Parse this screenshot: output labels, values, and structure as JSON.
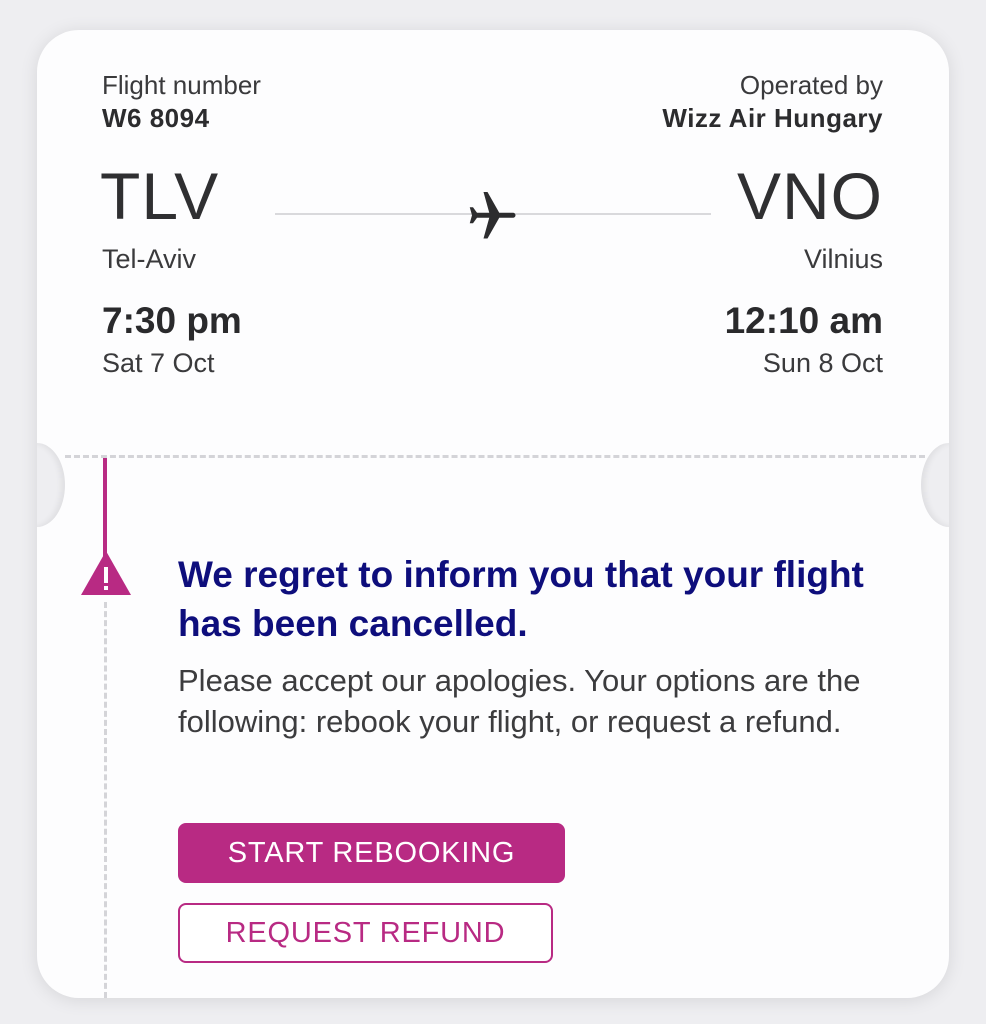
{
  "flight": {
    "number_label": "Flight number",
    "number": "W6 8094",
    "operator_label": "Operated by",
    "operator": "Wizz Air Hungary"
  },
  "origin": {
    "code": "TLV",
    "city": "Tel-Aviv",
    "time": "7:30 pm",
    "date": "Sat 7 Oct"
  },
  "destination": {
    "code": "VNO",
    "city": "Vilnius",
    "time": "12:10 am",
    "date": "Sun 8 Oct"
  },
  "alert": {
    "title": "We regret to inform you that your flight has been cancelled.",
    "body": "Please accept our apologies. Your options are the following: rebook your flight, or request a refund."
  },
  "actions": {
    "rebook_label": "START REBOOKING",
    "refund_label": "REQUEST REFUND"
  },
  "icons": {
    "plane": "airplane-icon",
    "warning": "warning-icon"
  },
  "colors": {
    "accent": "#b82a83",
    "alert_title": "#0e0e7c"
  }
}
